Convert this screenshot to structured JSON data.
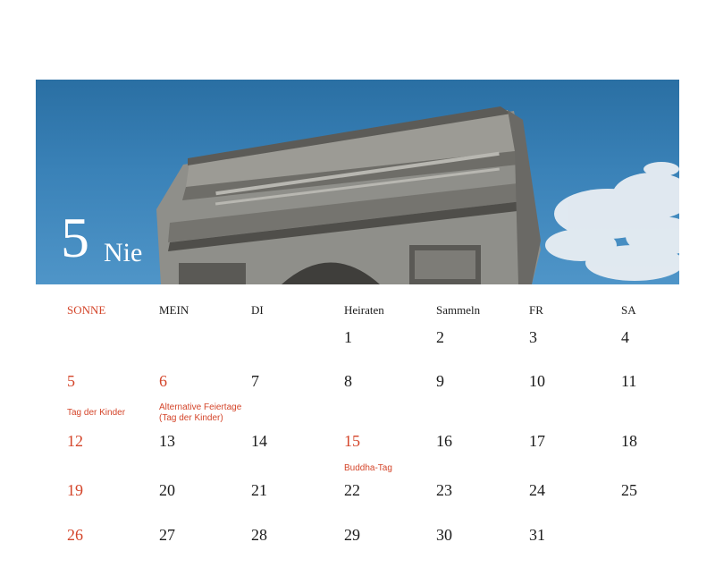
{
  "header": {
    "month_number": "5",
    "month_name": "Nie"
  },
  "weekdays": [
    "SONNE",
    "MEIN",
    "DI",
    "Heiraten",
    "Sammeln",
    "FR",
    "SA"
  ],
  "weeks": [
    [
      "",
      "",
      "",
      "1",
      "2",
      "3",
      "4"
    ],
    [
      "5",
      "6",
      "7",
      "8",
      "9",
      "10",
      "11"
    ],
    [
      "12",
      "13",
      "14",
      "15",
      "16",
      "17",
      "18"
    ],
    [
      "19",
      "20",
      "21",
      "22",
      "23",
      "24",
      "25"
    ],
    [
      "26",
      "27",
      "28",
      "29",
      "30",
      "31",
      ""
    ]
  ],
  "holidays": {
    "children_day": "Tag der Kinder",
    "alt_holiday": "Alternative Feiertage (Tag der Kinder)",
    "buddha_day": "Buddha-Tag"
  },
  "colors": {
    "accent": "#d4452a",
    "sky": "#3a82b8"
  }
}
